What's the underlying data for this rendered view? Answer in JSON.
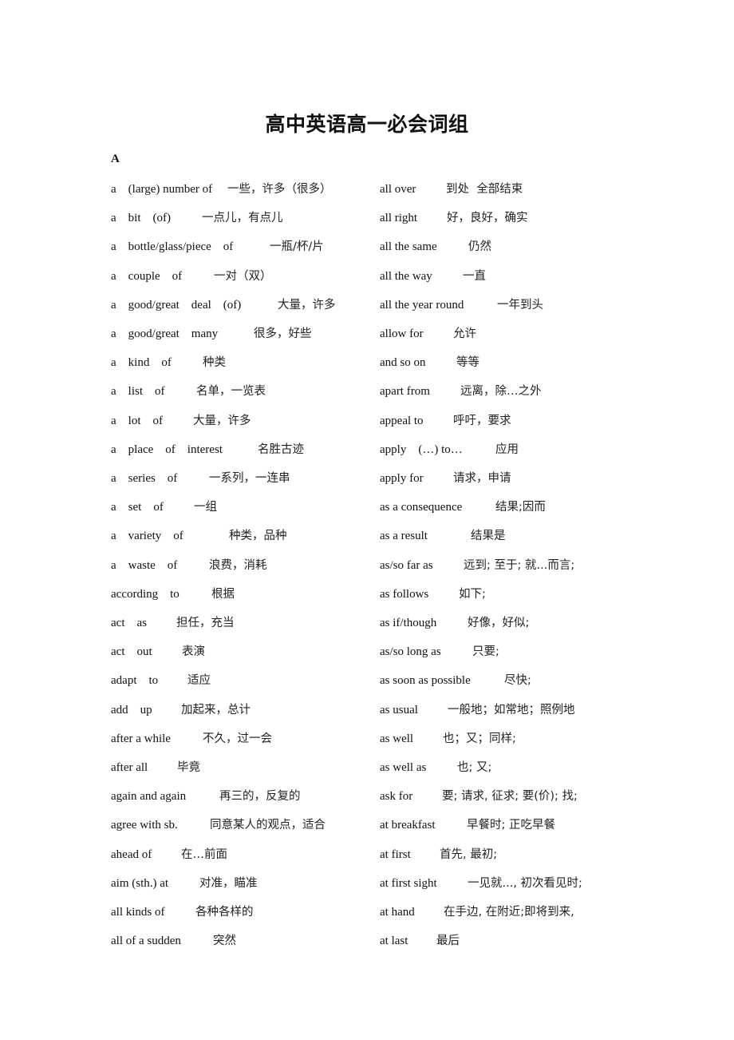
{
  "document": {
    "title": "高中英语高一必会词组",
    "section_letter": "A"
  },
  "left_column": [
    {
      "en": "a    (large) number of",
      "zh": "一些，许多（很多）"
    },
    {
      "en": "a    bit    (of)",
      "zh": "一点儿，有点儿"
    },
    {
      "en": "a    bottle/glass/piece    of",
      "zh": "一瓶/杯/片"
    },
    {
      "en": "a    couple    of",
      "zh": "一对（双）"
    },
    {
      "en": "a    good/great    deal    (of)",
      "zh": "大量，许多"
    },
    {
      "en": "a    good/great    many",
      "zh": "很多，好些"
    },
    {
      "en": "a    kind    of",
      "zh": "种类"
    },
    {
      "en": "a    list    of",
      "zh": "名单，一览表"
    },
    {
      "en": "a    lot    of",
      "zh": "大量，许多"
    },
    {
      "en": "a    place    of    interest",
      "zh": "名胜古迹"
    },
    {
      "en": "a    series    of",
      "zh": "一系列，一连串"
    },
    {
      "en": "a    set    of",
      "zh": "一组"
    },
    {
      "en": "a    variety    of",
      "zh": "种类，品种"
    },
    {
      "en": "a    waste    of",
      "zh": "浪费，消耗"
    },
    {
      "en": "according    to",
      "zh": "根据"
    },
    {
      "en": "act    as",
      "zh": "担任，充当"
    },
    {
      "en": "act    out",
      "zh": "表演"
    },
    {
      "en": "adapt    to",
      "zh": "适应"
    },
    {
      "en": "add    up",
      "zh": "加起来，总计"
    },
    {
      "en": "after a while",
      "zh": "不久，过一会"
    },
    {
      "en": "after all",
      "zh": "毕竟"
    },
    {
      "en": "again and again",
      "zh": "再三的，反复的"
    },
    {
      "en": "agree with sb.",
      "zh": "同意某人的观点，适合"
    },
    {
      "en": "ahead of",
      "zh": "在…前面"
    },
    {
      "en": "aim (sth.) at",
      "zh": "对准，瞄准"
    },
    {
      "en": "all kinds of",
      "zh": "各种各样的"
    },
    {
      "en": "all of a sudden",
      "zh": "突然"
    }
  ],
  "right_column": [
    {
      "en": "all over",
      "zh": "到处  全部结束"
    },
    {
      "en": "all right",
      "zh": "好，良好，确实"
    },
    {
      "en": "all the same",
      "zh": "仍然"
    },
    {
      "en": "all the way",
      "zh": "一直"
    },
    {
      "en": "all the year round",
      "zh": "一年到头"
    },
    {
      "en": "allow for",
      "zh": "允许"
    },
    {
      "en": "and so on",
      "zh": "等等"
    },
    {
      "en": "apart from",
      "zh": "远离，除…之外"
    },
    {
      "en": "appeal to",
      "zh": "呼吁，要求"
    },
    {
      "en": "apply    (…) to…",
      "zh": "应用"
    },
    {
      "en": "apply for",
      "zh": "请求，申请"
    },
    {
      "en": "as a consequence",
      "zh": "结果;因而"
    },
    {
      "en": "as a result",
      "zh": "结果是"
    },
    {
      "en": "as/so far as",
      "zh": "远到; 至于; 就...而言;"
    },
    {
      "en": "as follows",
      "zh": "如下;"
    },
    {
      "en": "as if/though",
      "zh": "好像，好似;"
    },
    {
      "en": "as/so long as",
      "zh": "只要;"
    },
    {
      "en": "as soon as possible",
      "zh": "尽快;"
    },
    {
      "en": "as usual",
      "zh": "一般地；如常地；照例地"
    },
    {
      "en": "as well",
      "zh": "也；又；同样;"
    },
    {
      "en": "as well as",
      "zh": "也; 又;"
    },
    {
      "en": "ask for",
      "zh": "要; 请求, 征求; 要(价); 找;"
    },
    {
      "en": "at breakfast",
      "zh": "早餐时; 正吃早餐"
    },
    {
      "en": "at first",
      "zh": "首先, 最初;"
    },
    {
      "en": "at first sight",
      "zh": "一见就..., 初次看见时;"
    },
    {
      "en": "at hand",
      "zh": "在手边, 在附近;即将到来,"
    },
    {
      "en": "at last",
      "zh": "最后"
    }
  ]
}
